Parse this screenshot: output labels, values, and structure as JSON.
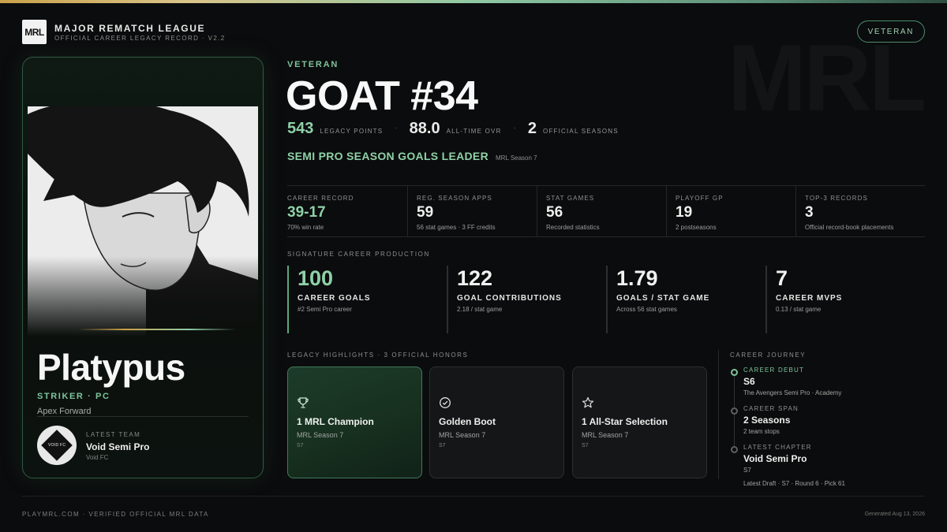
{
  "header": {
    "logo_text": "MRL",
    "league_name": "MAJOR REMATCH LEAGUE",
    "subtitle": "OFFICIAL CAREER LEGACY RECORD · V2.2",
    "tier_badge": "VETERAN",
    "watermark": "MRL"
  },
  "player": {
    "name": "Platypus",
    "position": "STRIKER · PC",
    "role": "Apex Forward",
    "latest_team_label": "LATEST TEAM",
    "latest_team": "Void Semi Pro",
    "club": "Void FC",
    "badge_text": "VOID FC"
  },
  "hero": {
    "tier": "VETERAN",
    "title": "GOAT #34",
    "legacy_points": "543",
    "legacy_points_label": "LEGACY POINTS",
    "ovr": "88.0",
    "ovr_label": "ALL-TIME OVR",
    "seasons": "2",
    "seasons_label": "OFFICIAL SEASONS",
    "separator": "·",
    "award": "SEMI PRO SEASON GOALS LEADER",
    "award_context": "MRL Season 7"
  },
  "record": [
    {
      "label": "CAREER RECORD",
      "value": "39-17",
      "note": "70% win rate"
    },
    {
      "label": "REG. SEASON APPS",
      "value": "59",
      "note": "56 stat games · 3 FF credits"
    },
    {
      "label": "STAT GAMES",
      "value": "56",
      "note": "Recorded statistics"
    },
    {
      "label": "PLAYOFF GP",
      "value": "19",
      "note": "2 postseasons"
    },
    {
      "label": "TOP-3 RECORDS",
      "value": "3",
      "note": "Official record-book placements"
    }
  ],
  "production": {
    "section_label": "SIGNATURE CAREER PRODUCTION",
    "items": [
      {
        "value": "100",
        "label": "CAREER GOALS",
        "note": "#2 Semi Pro career"
      },
      {
        "value": "122",
        "label": "GOAL CONTRIBUTIONS",
        "note": "2.18 / stat game"
      },
      {
        "value": "1.79",
        "label": "GOALS / STAT GAME",
        "note": "Across 56 stat games"
      },
      {
        "value": "7",
        "label": "CAREER MVPS",
        "note": "0.13 / stat game"
      }
    ]
  },
  "highlights": {
    "section_label": "LEGACY HIGHLIGHTS · 3 OFFICIAL HONORS",
    "items": [
      {
        "icon": "trophy-icon",
        "title": "1 MRL Champion",
        "subtitle": "MRL Season 7",
        "code": "S7"
      },
      {
        "icon": "check-circle-icon",
        "title": "Golden Boot",
        "subtitle": "MRL Season 7",
        "code": "S7"
      },
      {
        "icon": "star-icon",
        "title": "1 All-Star Selection",
        "subtitle": "MRL Season 7",
        "code": "S7"
      }
    ]
  },
  "journey": {
    "section_label": "CAREER JOURNEY",
    "steps": [
      {
        "label": "CAREER DEBUT",
        "value": "S6",
        "note": "The Avengers Semi Pro · Academy"
      },
      {
        "label": "CAREER SPAN",
        "value": "2 Seasons",
        "note": "2 team stops"
      },
      {
        "label": "LATEST CHAPTER",
        "value": "Void Semi Pro",
        "note": "S7",
        "note2": "Latest Draft · S7 · Round 6 · Pick 61"
      }
    ]
  },
  "footer": {
    "left": "PLAYMRL.COM · VERIFIED OFFICIAL MRL DATA",
    "right": "Generated Aug 13, 2026"
  },
  "colors": {
    "accent_green": "#8fd1a8",
    "gold": "#c9a24a",
    "background": "#0b0c0d"
  }
}
